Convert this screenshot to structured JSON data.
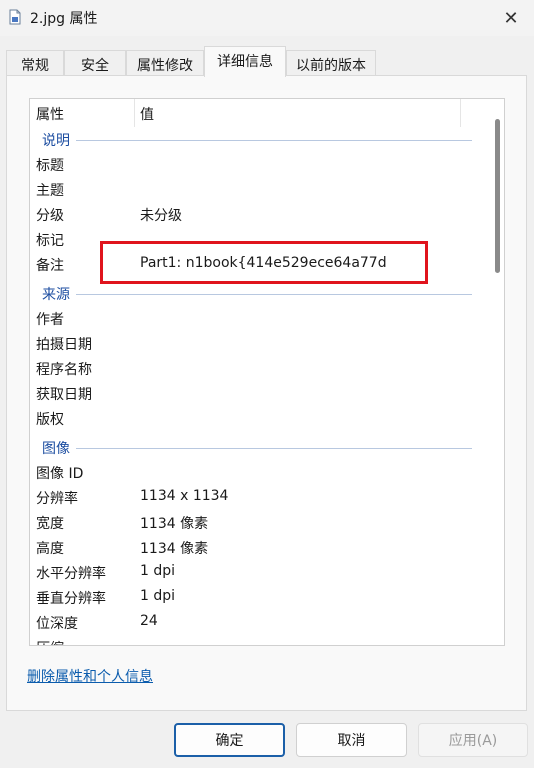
{
  "window": {
    "title": "2.jpg 属性",
    "close_glyph": "✕",
    "icon": "document-icon"
  },
  "tabs": [
    {
      "label": "常规",
      "active": false
    },
    {
      "label": "安全",
      "active": false
    },
    {
      "label": "属性修改",
      "active": false
    },
    {
      "label": "详细信息",
      "active": true
    },
    {
      "label": "以前的版本",
      "active": false
    }
  ],
  "details": {
    "header": {
      "name": "属性",
      "value": "值"
    },
    "groups": {
      "description": "说明",
      "origin": "来源",
      "image": "图像"
    },
    "rows": {
      "title": {
        "k": "标题",
        "v": ""
      },
      "subject": {
        "k": "主题",
        "v": ""
      },
      "rating": {
        "k": "分级",
        "v": "未分级"
      },
      "tags": {
        "k": "标记",
        "v": ""
      },
      "comments": {
        "k": "备注",
        "v": "Part1: n1book{414e529ece64a77d"
      },
      "authors": {
        "k": "作者",
        "v": ""
      },
      "date_taken": {
        "k": "拍摄日期",
        "v": ""
      },
      "program_name": {
        "k": "程序名称",
        "v": ""
      },
      "date_acquired": {
        "k": "获取日期",
        "v": ""
      },
      "copyright": {
        "k": "版权",
        "v": ""
      },
      "image_id": {
        "k": "图像 ID",
        "v": ""
      },
      "dimensions": {
        "k": "分辨率",
        "v": "1134 x 1134"
      },
      "width": {
        "k": "宽度",
        "v": "1134 像素"
      },
      "height": {
        "k": "高度",
        "v": "1134 像素"
      },
      "h_resolution": {
        "k": "水平分辨率",
        "v": "1 dpi"
      },
      "v_resolution": {
        "k": "垂直分辨率",
        "v": "1 dpi"
      },
      "bit_depth": {
        "k": "位深度",
        "v": "24"
      },
      "compression": {
        "k": "压缩",
        "v": ""
      }
    }
  },
  "remove_link": "删除属性和个人信息",
  "buttons": {
    "ok": "确定",
    "cancel": "取消",
    "apply": "应用(A)"
  },
  "colors": {
    "highlight": "#e0141d",
    "group_text": "#1d4ea1",
    "link": "#0b5cad",
    "primary_border": "#1b5fa8"
  }
}
